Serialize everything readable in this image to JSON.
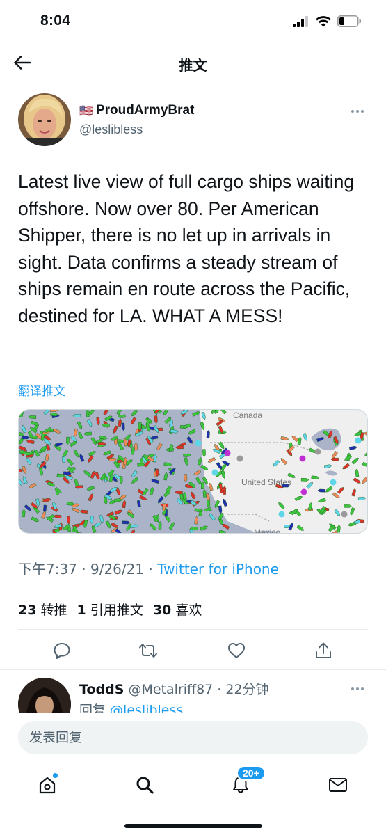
{
  "status_bar": {
    "time": "8:04"
  },
  "nav": {
    "title": "推文"
  },
  "tweet": {
    "author_flag": "🇺🇸",
    "author_name": "ProudArmyBrat",
    "author_handle": "@leslibless",
    "text": "Latest live view of full cargo ships waiting offshore. Now over 80. Per American Shipper, there is no let up in arrivals in sight. Data confirms a steady stream of ships remain en route across the Pacific, destined for LA. WHAT A MESS!",
    "translate_label": "翻译推文",
    "media": {
      "map_label_canada": "Canada",
      "map_label_us": "United States",
      "map_label_mexico": "Mexico"
    },
    "timestamp": "下午7:37 · 9/26/21 · ",
    "source": "Twitter for iPhone",
    "stats": {
      "retweets_count": "23",
      "retweets_label": "转推",
      "quotes_count": "1",
      "quotes_label": "引用推文",
      "likes_count": "30",
      "likes_label": "喜欢"
    }
  },
  "reply": {
    "name": "ToddS",
    "handle_time": "@Metalriff87 · 22分钟",
    "reply_prefix": "回复 ",
    "mention": "@leslibless"
  },
  "composer": {
    "placeholder": "发表回复"
  },
  "tab_bar": {
    "notifications_badge": "20+",
    "icons": [
      "home-icon",
      "search-icon",
      "bell-icon",
      "mail-icon"
    ]
  },
  "colors": {
    "accent": "#1d9bf0",
    "text": "#0f1419",
    "secondary": "#536471"
  }
}
